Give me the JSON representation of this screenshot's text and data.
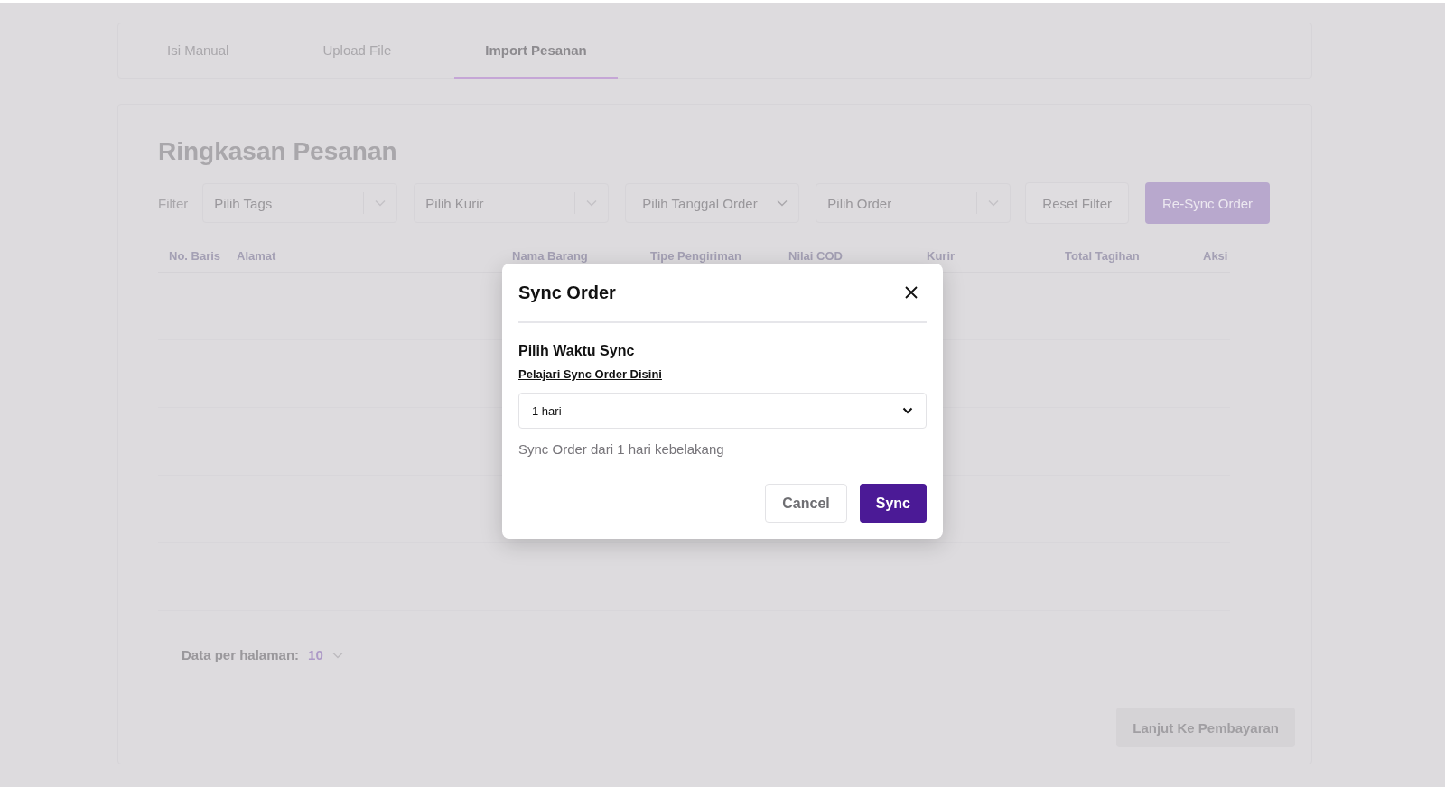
{
  "tabs": [
    {
      "label": "Isi Manual",
      "selected": false
    },
    {
      "label": "Upload File",
      "selected": false
    },
    {
      "label": "Import Pesanan",
      "selected": true
    }
  ],
  "summary": {
    "title": "Ringkasan Pesanan",
    "filter_label": "Filter",
    "filters": [
      {
        "placeholder": "Pilih Tags",
        "kind": "select"
      },
      {
        "placeholder": "Pilih Kurir",
        "kind": "select"
      },
      {
        "placeholder": "Pilih Tanggal Order",
        "kind": "date"
      },
      {
        "placeholder": "Pilih Order",
        "kind": "select"
      }
    ],
    "reset_button": "Reset Filter",
    "resync_button": "Re-Sync Order",
    "table": {
      "columns": [
        "No. Baris",
        "Alamat",
        "Nama Barang",
        "Tipe Pengiriman",
        "Nilai COD",
        "Kurir",
        "Total Tagihan",
        "Aksi"
      ]
    },
    "page_size_label": "Data per halaman:",
    "page_size": "10",
    "next_button": {
      "label": "Lanjut Ke Pembayaran",
      "disabled": true
    }
  },
  "modal": {
    "title": "Sync Order",
    "field_label": "Pilih Waktu Sync",
    "help_link": "Pelajari Sync Order Disini",
    "value": "1 hari",
    "hint": "Sync Order dari 1 hari kebelakang",
    "buttons": [
      {
        "label": "Cancel",
        "kind": "secondary"
      },
      {
        "label": "Sync",
        "kind": "primary"
      }
    ]
  }
}
